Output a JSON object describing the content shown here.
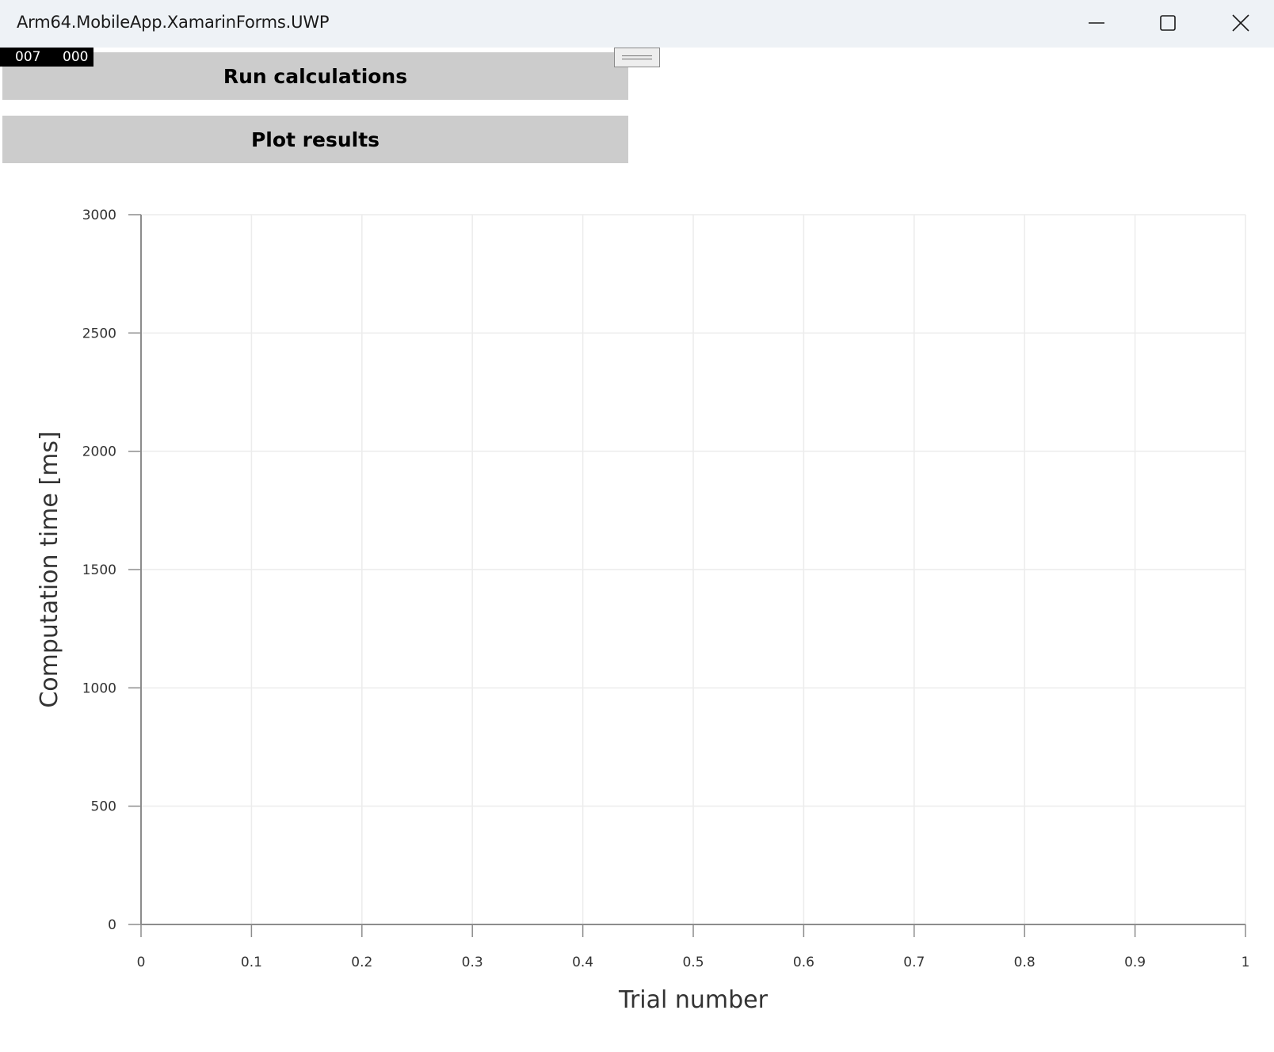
{
  "window": {
    "title": "Arm64.MobileApp.XamarinForms.UWP",
    "controls": [
      "minimize-icon",
      "maximize-icon",
      "close-icon"
    ]
  },
  "debug_overlay": {
    "frame_counter_a": "007",
    "frame_counter_b": "000"
  },
  "buttons": {
    "run_label": "Run calculations",
    "plot_label": "Plot results"
  },
  "colors": {
    "titlebar": "#eef2f6",
    "button_bg": "#cccccc",
    "grid": "#ececec",
    "axis": "#8c8c8c"
  },
  "chart_data": {
    "type": "line",
    "title": "",
    "xlabel": "Trial number",
    "ylabel": "Computation time [ms]",
    "xlim": [
      0,
      1
    ],
    "ylim": [
      0,
      3000
    ],
    "x_ticks": [
      0,
      0.1,
      0.2,
      0.3,
      0.4,
      0.5,
      0.6,
      0.7,
      0.8,
      0.9,
      1
    ],
    "x_tick_labels": [
      "0",
      "0.1",
      "0.2",
      "0.3",
      "0.4",
      "0.5",
      "0.6",
      "0.7",
      "0.8",
      "0.9",
      "1"
    ],
    "y_ticks": [
      0,
      500,
      1000,
      1500,
      2000,
      2500,
      3000
    ],
    "y_tick_labels": [
      "0",
      "500",
      "1000",
      "1500",
      "2000",
      "2500",
      "3000"
    ],
    "grid": true,
    "series": []
  }
}
